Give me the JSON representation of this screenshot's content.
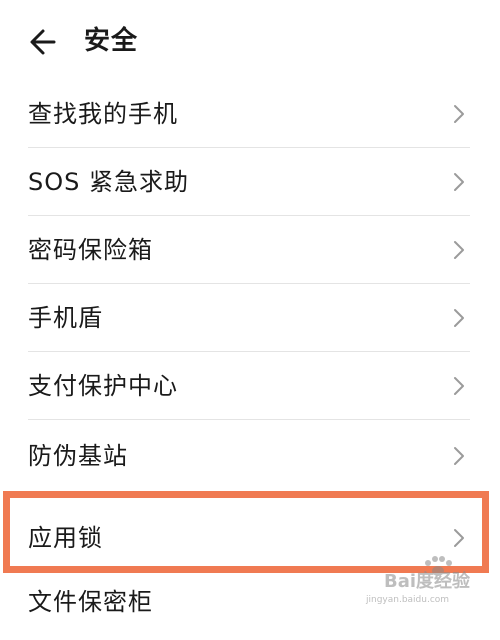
{
  "header": {
    "title": "安全"
  },
  "items": [
    {
      "label": "查找我的手机"
    },
    {
      "label": "SOS 紧急求助"
    },
    {
      "label": "密码保险箱"
    },
    {
      "label": "手机盾"
    },
    {
      "label": "支付保护中心"
    },
    {
      "label": "防伪基站"
    },
    {
      "label": "应用锁"
    },
    {
      "label": "文件保密柜"
    }
  ],
  "watermark": {
    "brand": "Bai度经验",
    "url": "jingyan.baidu.com"
  },
  "colors": {
    "highlight": "#f07a52",
    "divider": "#e4e4e4",
    "chevron": "#9b9b9b"
  },
  "icons": {
    "back": "arrow-left-icon",
    "chevron": "chevron-right-icon"
  }
}
